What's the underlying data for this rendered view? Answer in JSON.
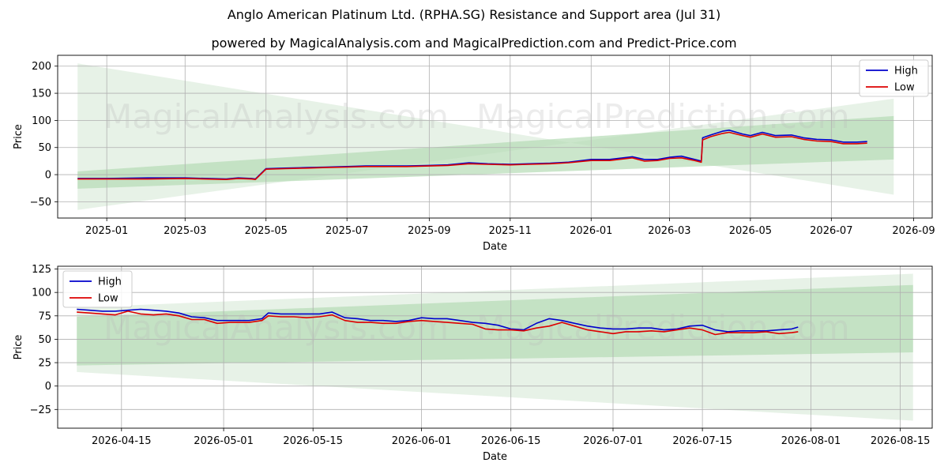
{
  "title": "Anglo American Platinum Ltd. (RPHA.SG) Resistance and Support area (Jul 31)",
  "subtitle": "powered by MagicalAnalysis.com and MagicalPrediction.com and Predict-Price.com",
  "watermarks": [
    "MagicalAnalysis.com",
    "MagicalPrediction.com"
  ],
  "colors": {
    "high": "#0000cc",
    "low": "#dd0000",
    "band_light": "#e3f0e3",
    "band_dark": "#b5dbb5",
    "grid": "#b0b0b0"
  },
  "chart_data": [
    {
      "type": "line",
      "xlabel": "Date",
      "ylabel": "Price",
      "xlim": [
        "2024-11-25",
        "2026-09-15"
      ],
      "ylim": [
        -80,
        220
      ],
      "xticks": [
        "2025-01",
        "2025-03",
        "2025-05",
        "2025-07",
        "2025-09",
        "2025-11",
        "2026-01",
        "2026-03",
        "2026-05",
        "2026-07",
        "2026-09"
      ],
      "xtick_dates": [
        "2025-01-01",
        "2025-03-01",
        "2025-05-01",
        "2025-07-01",
        "2025-09-01",
        "2025-11-01",
        "2026-01-01",
        "2026-03-01",
        "2026-05-01",
        "2026-07-01",
        "2026-09-01"
      ],
      "yticks": [
        -50,
        0,
        50,
        100,
        150,
        200
      ],
      "legend": "top-right",
      "grid": true,
      "bands": [
        {
          "x": [
            "2024-12-10",
            "2026-08-17"
          ],
          "upper": [
            205,
            -37
          ],
          "lower": [
            -65,
            140
          ],
          "shade": "light"
        },
        {
          "x": [
            "2024-12-10",
            "2026-08-17"
          ],
          "upper": [
            6,
            108
          ],
          "lower": [
            -26,
            28
          ],
          "shade": "dark"
        }
      ],
      "x": [
        "2024-12-10",
        "2025-01-01",
        "2025-02-01",
        "2025-03-01",
        "2025-04-01",
        "2025-04-10",
        "2025-04-20",
        "2025-04-23",
        "2025-05-01",
        "2025-05-15",
        "2025-06-01",
        "2025-06-15",
        "2025-07-01",
        "2025-07-15",
        "2025-08-01",
        "2025-08-15",
        "2025-09-01",
        "2025-09-15",
        "2025-10-01",
        "2025-10-15",
        "2025-11-01",
        "2025-11-15",
        "2025-12-01",
        "2025-12-15",
        "2026-01-01",
        "2026-01-15",
        "2026-02-01",
        "2026-02-10",
        "2026-02-20",
        "2026-03-01",
        "2026-03-10",
        "2026-03-20",
        "2026-03-25",
        "2026-03-26",
        "2026-04-01",
        "2026-04-10",
        "2026-04-15",
        "2026-04-25",
        "2026-05-01",
        "2026-05-10",
        "2026-05-20",
        "2026-06-01",
        "2026-06-10",
        "2026-06-20",
        "2026-07-01",
        "2026-07-10",
        "2026-07-20",
        "2026-07-28"
      ],
      "series": [
        {
          "name": "High",
          "color": "#0000cc",
          "values": [
            -7,
            -7,
            -6,
            -6,
            -8,
            -6,
            -7,
            -8,
            11,
            12,
            13,
            14,
            15,
            16,
            16,
            16,
            17,
            18,
            22,
            20,
            19,
            20,
            21,
            23,
            28,
            28,
            33,
            28,
            28,
            32,
            34,
            28,
            25,
            68,
            73,
            80,
            82,
            75,
            72,
            78,
            72,
            73,
            68,
            65,
            64,
            60,
            60,
            61
          ]
        },
        {
          "name": "Low",
          "color": "#dd0000",
          "values": [
            -8,
            -8,
            -8,
            -7,
            -9,
            -7,
            -8,
            -9,
            10,
            11,
            12,
            13,
            14,
            15,
            15,
            15,
            16,
            17,
            20,
            19,
            18,
            19,
            20,
            22,
            26,
            26,
            31,
            25,
            26,
            30,
            31,
            26,
            23,
            64,
            70,
            76,
            78,
            72,
            69,
            75,
            69,
            70,
            65,
            62,
            61,
            57,
            57,
            58
          ]
        }
      ]
    },
    {
      "type": "line",
      "xlabel": "Date",
      "ylabel": "Price",
      "xlim": [
        "2026-04-05",
        "2026-08-20"
      ],
      "ylim": [
        -45,
        128
      ],
      "xticks": [
        "2026-04-15",
        "2026-05-01",
        "2026-05-15",
        "2026-06-01",
        "2026-06-15",
        "2026-07-01",
        "2026-07-15",
        "2026-08-01",
        "2026-08-15"
      ],
      "yticks": [
        -25,
        0,
        25,
        50,
        75,
        100,
        125
      ],
      "legend": "top-left",
      "grid": true,
      "bands": [
        {
          "x": [
            "2026-04-08",
            "2026-08-17"
          ],
          "upper": [
            84,
            120
          ],
          "lower": [
            15,
            -37
          ],
          "shade": "light"
        },
        {
          "x": [
            "2026-04-08",
            "2026-08-17"
          ],
          "upper": [
            74,
            108
          ],
          "lower": [
            22,
            36
          ],
          "shade": "dark"
        }
      ],
      "x": [
        "2026-04-08",
        "2026-04-10",
        "2026-04-12",
        "2026-04-14",
        "2026-04-16",
        "2026-04-18",
        "2026-04-20",
        "2026-04-22",
        "2026-04-24",
        "2026-04-26",
        "2026-04-28",
        "2026-04-30",
        "2026-05-02",
        "2026-05-05",
        "2026-05-07",
        "2026-05-08",
        "2026-05-10",
        "2026-05-12",
        "2026-05-14",
        "2026-05-16",
        "2026-05-18",
        "2026-05-20",
        "2026-05-22",
        "2026-05-24",
        "2026-05-26",
        "2026-05-28",
        "2026-05-30",
        "2026-06-01",
        "2026-06-03",
        "2026-06-05",
        "2026-06-07",
        "2026-06-09",
        "2026-06-11",
        "2026-06-13",
        "2026-06-15",
        "2026-06-17",
        "2026-06-19",
        "2026-06-21",
        "2026-06-23",
        "2026-06-25",
        "2026-06-27",
        "2026-06-29",
        "2026-07-01",
        "2026-07-03",
        "2026-07-05",
        "2026-07-07",
        "2026-07-09",
        "2026-07-11",
        "2026-07-13",
        "2026-07-15",
        "2026-07-17",
        "2026-07-19",
        "2026-07-21",
        "2026-07-23",
        "2026-07-25",
        "2026-07-27",
        "2026-07-29",
        "2026-07-30"
      ],
      "series": [
        {
          "name": "High",
          "color": "#0000cc",
          "values": [
            82,
            81,
            80,
            80,
            81,
            82,
            81,
            80,
            78,
            74,
            73,
            70,
            70,
            70,
            72,
            78,
            77,
            77,
            77,
            77,
            79,
            73,
            72,
            70,
            70,
            69,
            70,
            73,
            72,
            72,
            70,
            68,
            67,
            65,
            61,
            60,
            67,
            72,
            70,
            67,
            64,
            62,
            61,
            61,
            62,
            62,
            60,
            61,
            64,
            65,
            60,
            58,
            59,
            59,
            59,
            60,
            61,
            63
          ]
        },
        {
          "name": "Low",
          "color": "#dd0000",
          "values": [
            79,
            78,
            77,
            76,
            80,
            77,
            76,
            77,
            75,
            71,
            71,
            67,
            68,
            68,
            70,
            75,
            74,
            74,
            73,
            74,
            76,
            70,
            68,
            68,
            67,
            67,
            69,
            70,
            69,
            68,
            67,
            66,
            61,
            60,
            60,
            59,
            62,
            64,
            68,
            64,
            60,
            58,
            56,
            58,
            58,
            59,
            58,
            60,
            62,
            60,
            55,
            57,
            57,
            57,
            58,
            56,
            57,
            58
          ]
        }
      ]
    }
  ]
}
